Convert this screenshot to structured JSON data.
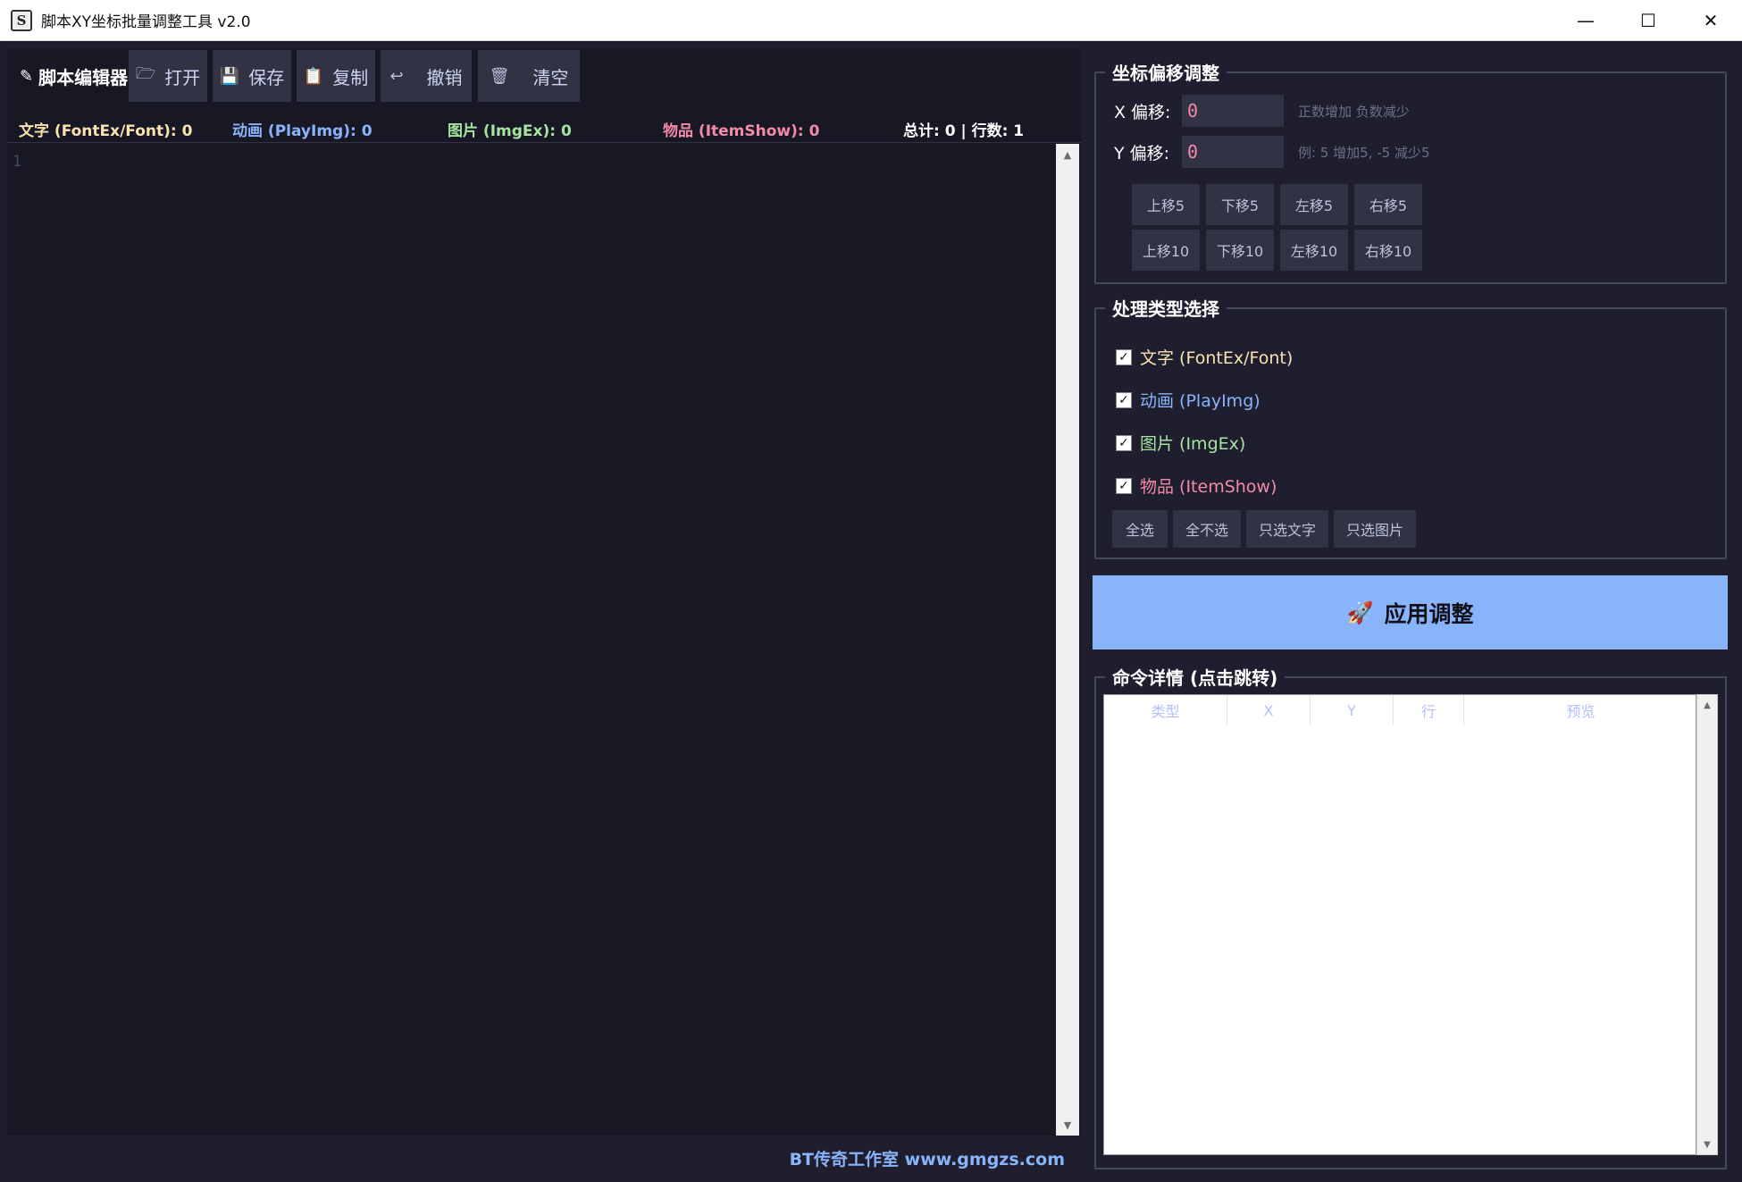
{
  "window": {
    "title": "脚本XY坐标批量调整工具 v2.0",
    "minimize": "—",
    "maximize": "☐",
    "close": "✕"
  },
  "editor": {
    "title": "脚本编辑器",
    "toolbar": [
      {
        "label": "打开",
        "icon": "folder-open-icon",
        "glyph": "🗁"
      },
      {
        "label": "保存",
        "icon": "save-icon",
        "glyph": "💾"
      },
      {
        "label": "复制",
        "icon": "copy-icon",
        "glyph": "📋"
      },
      {
        "label": "撤销",
        "icon": "undo-icon",
        "glyph": "↩"
      },
      {
        "label": "清空",
        "icon": "clear-icon",
        "glyph": "🗑"
      }
    ],
    "status": {
      "text": "文字 (FontEx/Font): 0",
      "anim": "动画 (PlayImg): 0",
      "image": "图片 (ImgEx): 0",
      "item": "物品 (ItemShow): 0",
      "total": "总计: 0 | 行数: 1"
    },
    "line_number": "1",
    "footer": "BT传奇工作室  www.gmgzs.com"
  },
  "offset": {
    "title": "坐标偏移调整",
    "x_label": "X 偏移:",
    "x_value": "0",
    "x_hint": "正数增加 负数减少",
    "y_label": "Y 偏移:",
    "y_value": "0",
    "y_hint": "例: 5 增加5, -5 减少5",
    "buttons_row1": [
      "上移5",
      "下移5",
      "左移5",
      "右移5"
    ],
    "buttons_row2": [
      "上移10",
      "下移10",
      "左移10",
      "右移10"
    ]
  },
  "types": {
    "title": "处理类型选择",
    "options": [
      {
        "label": "文字 (FontEx/Font)",
        "checked": true,
        "color": "#f9e2af"
      },
      {
        "label": "动画 (PlayImg)",
        "checked": true,
        "color": "#89b4fa"
      },
      {
        "label": "图片 (ImgEx)",
        "checked": true,
        "color": "#a6e3a1"
      },
      {
        "label": "物品 (ItemShow)",
        "checked": true,
        "color": "#f38ba8"
      }
    ],
    "buttons": [
      "全选",
      "全不选",
      "只选文字",
      "只选图片"
    ]
  },
  "apply": {
    "label": "应用调整",
    "icon": "rocket-icon"
  },
  "details": {
    "title": "命令详情 (点击跳转)",
    "columns": [
      "类型",
      "X",
      "Y",
      "行",
      "预览"
    ]
  },
  "colors": {
    "background": "#1e1e2e",
    "editor": "#181825",
    "button": "#313244",
    "accent": "#89b4fa"
  }
}
